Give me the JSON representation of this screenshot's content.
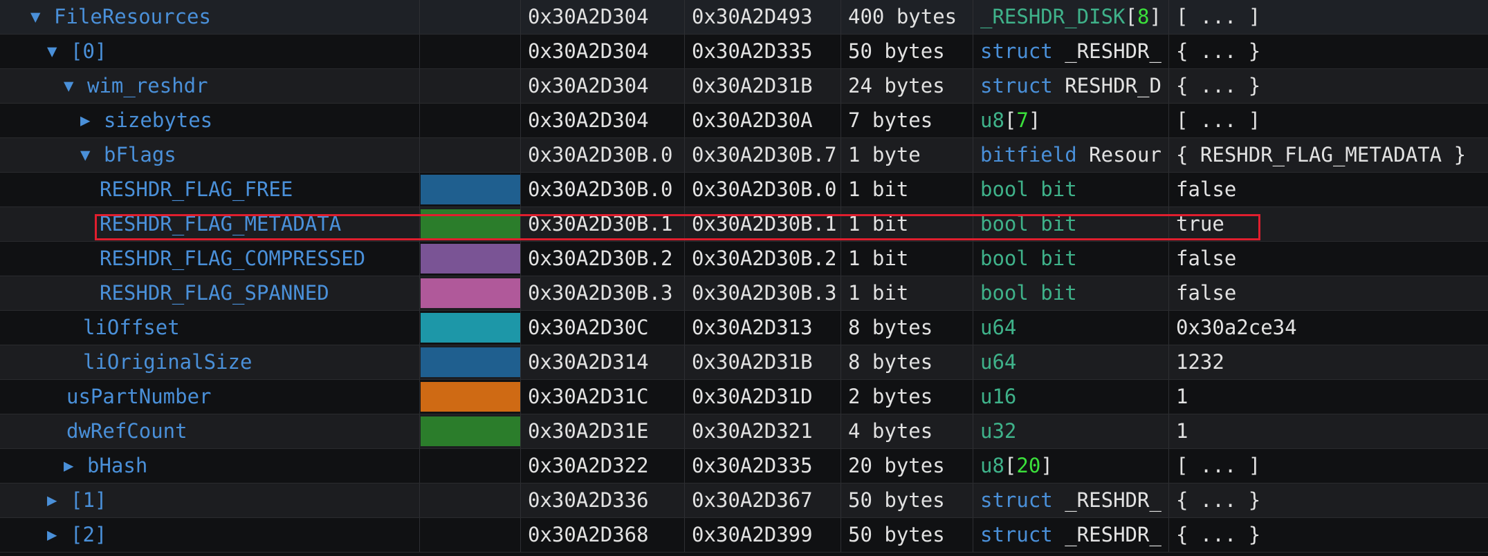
{
  "rows": [
    {
      "name": "FileResources",
      "toggle": "▼",
      "start": "0x30A2D304",
      "end": "0x30A2D493",
      "size": "400 bytes",
      "type_kw": "_RESHDR_DISK",
      "type_kw_color": "green",
      "type_name": "",
      "type_bracket_open": "[",
      "type_num": "8",
      "type_bracket_close": "]",
      "value": "[ ... ]",
      "swatch": ""
    },
    {
      "name": "[0]",
      "toggle": "▼",
      "start": "0x30A2D304",
      "end": "0x30A2D335",
      "size": "50 bytes",
      "type_kw": "struct",
      "type_kw_color": "blue",
      "type_name": " _RESHDR_",
      "type_bracket_open": "",
      "type_num": "",
      "type_bracket_close": "",
      "value": "{ ... }",
      "swatch": ""
    },
    {
      "name": "wim_reshdr",
      "toggle": "▼",
      "start": "0x30A2D304",
      "end": "0x30A2D31B",
      "size": "24 bytes",
      "type_kw": "struct",
      "type_kw_color": "blue",
      "type_name": " RESHDR_D",
      "type_bracket_open": "",
      "type_num": "",
      "type_bracket_close": "",
      "value": "{ ... }",
      "swatch": ""
    },
    {
      "name": "sizebytes",
      "toggle": "▶",
      "start": "0x30A2D304",
      "end": "0x30A2D30A",
      "size": "7 bytes",
      "type_kw": "u8",
      "type_kw_color": "green",
      "type_name": "",
      "type_bracket_open": "[",
      "type_num": "7",
      "type_bracket_close": "]",
      "value": "[ ... ]",
      "swatch": ""
    },
    {
      "name": "bFlags",
      "toggle": "▼",
      "start": "0x30A2D30B.0",
      "end": "0x30A2D30B.7",
      "size": "1 byte",
      "type_kw": "bitfield",
      "type_kw_color": "blue",
      "type_name": " Resour",
      "type_bracket_open": "",
      "type_num": "",
      "type_bracket_close": "",
      "value": "{ RESHDR_FLAG_METADATA }",
      "swatch": ""
    },
    {
      "name": "RESHDR_FLAG_FREE",
      "toggle": "",
      "start": "0x30A2D30B.0",
      "end": "0x30A2D30B.0",
      "size": "1 bit",
      "type_kw": "bool bit",
      "type_kw_color": "green",
      "type_name": "",
      "type_bracket_open": "",
      "type_num": "",
      "type_bracket_close": "",
      "value": "false",
      "swatch": "#1f5f8f"
    },
    {
      "name": "RESHDR_FLAG_METADATA",
      "toggle": "",
      "start": "0x30A2D30B.1",
      "end": "0x30A2D30B.1",
      "size": "1 bit",
      "type_kw": "bool bit",
      "type_kw_color": "green",
      "type_name": "",
      "type_bracket_open": "",
      "type_num": "",
      "type_bracket_close": "",
      "value": "true",
      "swatch": "#2b7d2b"
    },
    {
      "name": "RESHDR_FLAG_COMPRESSED",
      "toggle": "",
      "start": "0x30A2D30B.2",
      "end": "0x30A2D30B.2",
      "size": "1 bit",
      "type_kw": "bool bit",
      "type_kw_color": "green",
      "type_name": "",
      "type_bracket_open": "",
      "type_num": "",
      "type_bracket_close": "",
      "value": "false",
      "swatch": "#7a5495"
    },
    {
      "name": "RESHDR_FLAG_SPANNED",
      "toggle": "",
      "start": "0x30A2D30B.3",
      "end": "0x30A2D30B.3",
      "size": "1 bit",
      "type_kw": "bool bit",
      "type_kw_color": "green",
      "type_name": "",
      "type_bracket_open": "",
      "type_num": "",
      "type_bracket_close": "",
      "value": "false",
      "swatch": "#b0599a"
    },
    {
      "name": "liOffset",
      "toggle": "",
      "start": "0x30A2D30C",
      "end": "0x30A2D313",
      "size": "8 bytes",
      "type_kw": "u64",
      "type_kw_color": "green",
      "type_name": "",
      "type_bracket_open": "",
      "type_num": "",
      "type_bracket_close": "",
      "value": "0x30a2ce34",
      "swatch": "#1d97a8"
    },
    {
      "name": "liOriginalSize",
      "toggle": "",
      "start": "0x30A2D314",
      "end": "0x30A2D31B",
      "size": "8 bytes",
      "type_kw": "u64",
      "type_kw_color": "green",
      "type_name": "",
      "type_bracket_open": "",
      "type_num": "",
      "type_bracket_close": "",
      "value": "1232",
      "swatch": "#1f5f8f"
    },
    {
      "name": "usPartNumber",
      "toggle": "",
      "start": "0x30A2D31C",
      "end": "0x30A2D31D",
      "size": "2 bytes",
      "type_kw": "u16",
      "type_kw_color": "green",
      "type_name": "",
      "type_bracket_open": "",
      "type_num": "",
      "type_bracket_close": "",
      "value": "1",
      "swatch": "#cf6a14"
    },
    {
      "name": "dwRefCount",
      "toggle": "",
      "start": "0x30A2D31E",
      "end": "0x30A2D321",
      "size": "4 bytes",
      "type_kw": "u32",
      "type_kw_color": "green",
      "type_name": "",
      "type_bracket_open": "",
      "type_num": "",
      "type_bracket_close": "",
      "value": "1",
      "swatch": "#2b7d2b"
    },
    {
      "name": "bHash",
      "toggle": "▶",
      "start": "0x30A2D322",
      "end": "0x30A2D335",
      "size": "20 bytes",
      "type_kw": "u8",
      "type_kw_color": "green",
      "type_name": "",
      "type_bracket_open": "[",
      "type_num": "20",
      "type_bracket_close": "]",
      "value": "[ ... ]",
      "swatch": ""
    },
    {
      "name": "[1]",
      "toggle": "▶",
      "start": "0x30A2D336",
      "end": "0x30A2D367",
      "size": "50 bytes",
      "type_kw": "struct",
      "type_kw_color": "blue",
      "type_name": " _RESHDR_",
      "type_bracket_open": "",
      "type_num": "",
      "type_bracket_close": "",
      "value": "{ ... }",
      "swatch": ""
    },
    {
      "name": "[2]",
      "toggle": "▶",
      "start": "0x30A2D368",
      "end": "0x30A2D399",
      "size": "50 bytes",
      "type_kw": "struct",
      "type_kw_color": "blue",
      "type_name": " _RESHDR_",
      "type_bracket_open": "",
      "type_num": "",
      "type_bracket_close": "",
      "value": "{ ... }",
      "swatch": ""
    }
  ]
}
